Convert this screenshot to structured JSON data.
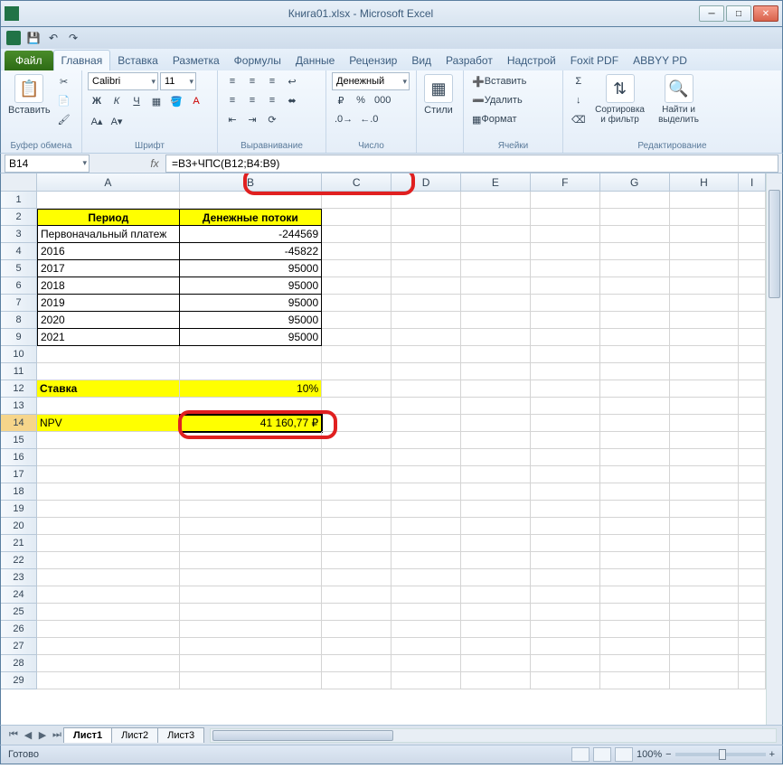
{
  "window": {
    "title": "Книга01.xlsx - Microsoft Excel"
  },
  "ribbon": {
    "file": "Файл",
    "tabs": [
      "Главная",
      "Вставка",
      "Разметка",
      "Формулы",
      "Данные",
      "Рецензир",
      "Вид",
      "Разработ",
      "Надстрой",
      "Foxit PDF",
      "ABBYY PD"
    ],
    "active_tab": 0,
    "groups": {
      "clipboard": {
        "label": "Буфер обмена",
        "paste": "Вставить"
      },
      "font": {
        "label": "Шрифт",
        "name": "Calibri",
        "size": "11",
        "bold": "Ж",
        "italic": "К",
        "underline": "Ч"
      },
      "align": {
        "label": "Выравнивание"
      },
      "number": {
        "label": "Число",
        "format": "Денежный"
      },
      "styles": {
        "label": "Стили",
        "btn": "Стили"
      },
      "cells": {
        "label": "Ячейки",
        "insert": "Вставить",
        "delete": "Удалить",
        "format": "Формат"
      },
      "editing": {
        "label": "Редактирование",
        "sort": "Сортировка и фильтр",
        "find": "Найти и выделить"
      }
    }
  },
  "name_box": "B14",
  "formula": "=B3+ЧПС(B12;B4:B9)",
  "columns": [
    "A",
    "B",
    "C",
    "D",
    "E",
    "F",
    "G",
    "H",
    "I"
  ],
  "table": {
    "h1": "Период",
    "h2": "Денежные потоки",
    "rows": [
      {
        "a": "Первоначальный платеж",
        "b": "-244569"
      },
      {
        "a": "2016",
        "b": "-45822"
      },
      {
        "a": "2017",
        "b": "95000"
      },
      {
        "a": "2018",
        "b": "95000"
      },
      {
        "a": "2019",
        "b": "95000"
      },
      {
        "a": "2020",
        "b": "95000"
      },
      {
        "a": "2021",
        "b": "95000"
      }
    ],
    "rate_label": "Ставка",
    "rate_val": "10%",
    "npv_label": "NPV",
    "npv_val": "41 160,77 ₽"
  },
  "sheets": {
    "list": [
      "Лист1",
      "Лист2",
      "Лист3"
    ],
    "active": 0
  },
  "status": {
    "ready": "Готово",
    "zoom": "100%",
    "minus": "−",
    "plus": "+"
  },
  "rows_header_count": 29
}
